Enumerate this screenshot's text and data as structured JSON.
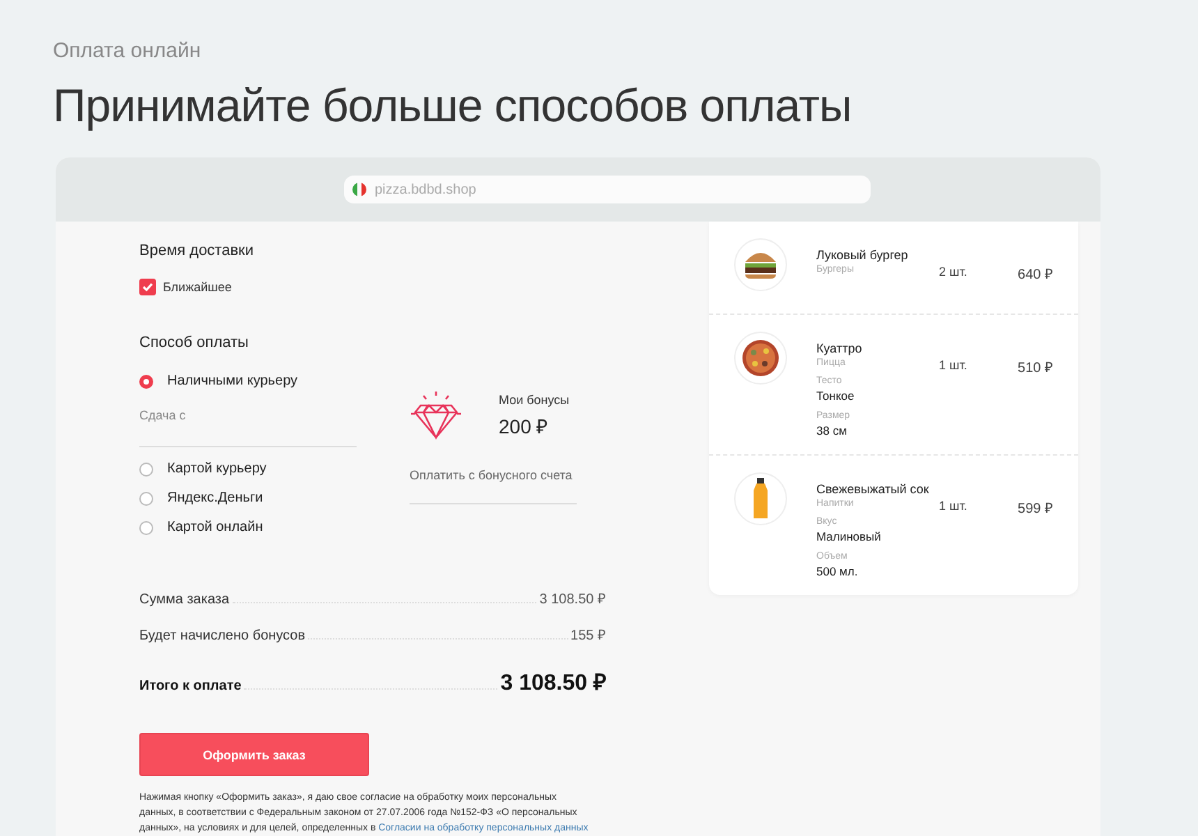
{
  "section_label": "Оплата онлайн",
  "heading": "Принимайте больше способов оплаты",
  "browser": {
    "url": "pizza.bdbd.shop"
  },
  "delivery": {
    "title": "Время доставки",
    "option": {
      "label": "Ближайшее",
      "checked": true
    }
  },
  "payment": {
    "title": "Способ оплаты",
    "methods": [
      {
        "label": "Наличными курьеру",
        "selected": true
      },
      {
        "label": "Картой курьеру",
        "selected": false
      },
      {
        "label": "Яндекс.Деньги",
        "selected": false
      },
      {
        "label": "Картой онлайн",
        "selected": false
      }
    ],
    "change_field": {
      "label": "Сдача с"
    }
  },
  "bonus": {
    "label": "Мои бонусы",
    "amount": "200 ₽",
    "pay_field": {
      "label": "Оплатить с бонусного счета"
    }
  },
  "summary": [
    {
      "label": "Сумма заказа",
      "value": "3 108.50 ₽",
      "kind": "normal"
    },
    {
      "label": "Будет начислено бонусов",
      "value": "155 ₽",
      "kind": "normal"
    },
    {
      "label": "Итого к оплате",
      "value": "3 108.50 ₽",
      "kind": "total"
    }
  ],
  "submit_button": "Оформить заказ",
  "consent": {
    "text": "Нажимая кнопку «Оформить заказ», я даю свое согласие на обработку моих персональных данных, в соответствии с Федеральным законом от 27.07.2006 года №152-ФЗ «О персональных данных», на условиях и для целей, определенных в",
    "link": "Согласии на обработку персональных данных"
  },
  "cart": [
    {
      "name": "Луковый бургер",
      "category": "Бургеры",
      "kind": "burger",
      "quantity": "2 шт.",
      "price": "640 ₽"
    },
    {
      "name": "Куаттро",
      "category": "Пицца",
      "kind": "pizza",
      "options": [
        {
          "label": "Тесто",
          "value": "Тонкое"
        },
        {
          "label": "Размер",
          "value": "38 см"
        }
      ],
      "quantity": "1 шт.",
      "price": "510 ₽"
    },
    {
      "name": "Свежевыжатый сок",
      "category": "Напитки",
      "kind": "juice",
      "options": [
        {
          "label": "Вкус",
          "value": "Малиновый"
        },
        {
          "label": "Объем",
          "value": "500 мл."
        }
      ],
      "quantity": "1 шт.",
      "price": "599 ₽"
    }
  ]
}
